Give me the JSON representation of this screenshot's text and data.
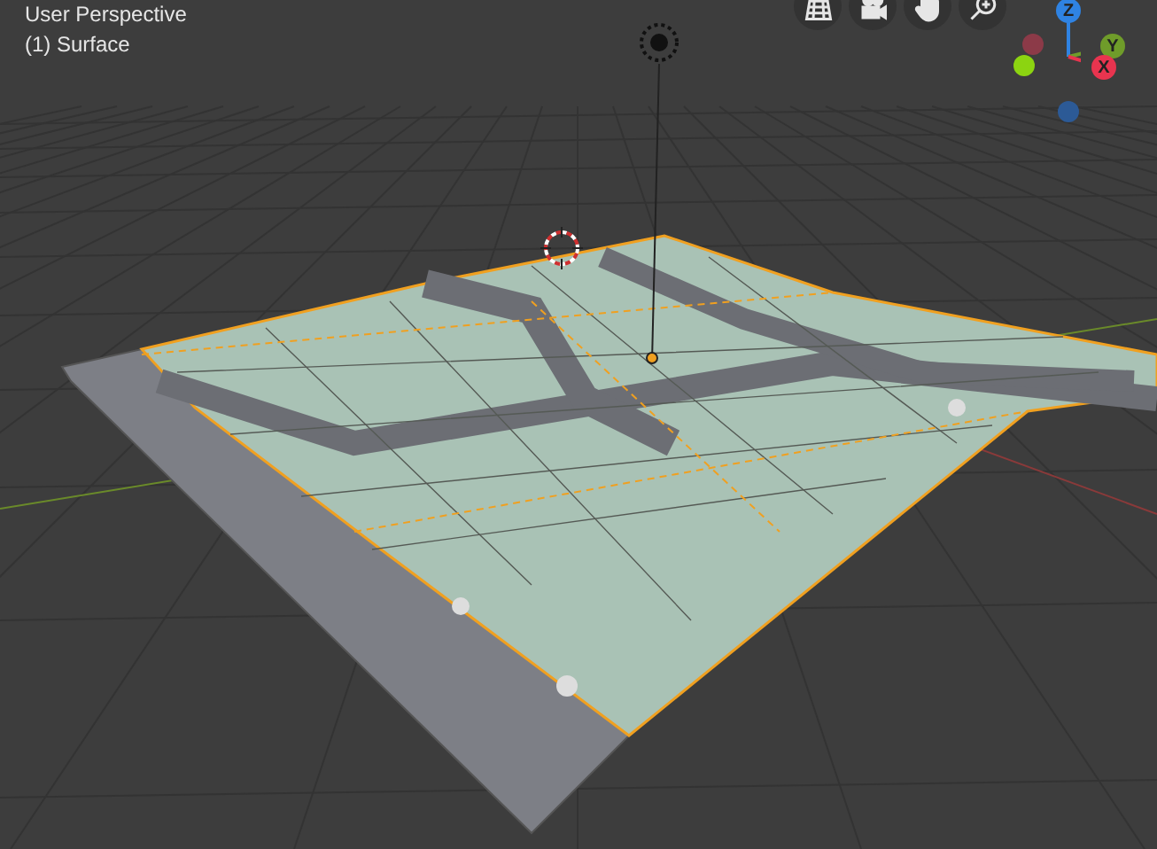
{
  "viewport": {
    "view_name": "User Perspective",
    "object_label": "(1) Surface"
  },
  "navigation": [
    {
      "kind": "grid"
    },
    {
      "kind": "camera"
    },
    {
      "kind": "hand"
    },
    {
      "kind": "zoom"
    }
  ],
  "gizmo": {
    "axes": [
      {
        "label": "Z",
        "color": "#2f83e3"
      },
      {
        "label": "Y",
        "color": "#6f9c2a"
      },
      {
        "label": "X",
        "color": "#e8344f"
      }
    ]
  }
}
